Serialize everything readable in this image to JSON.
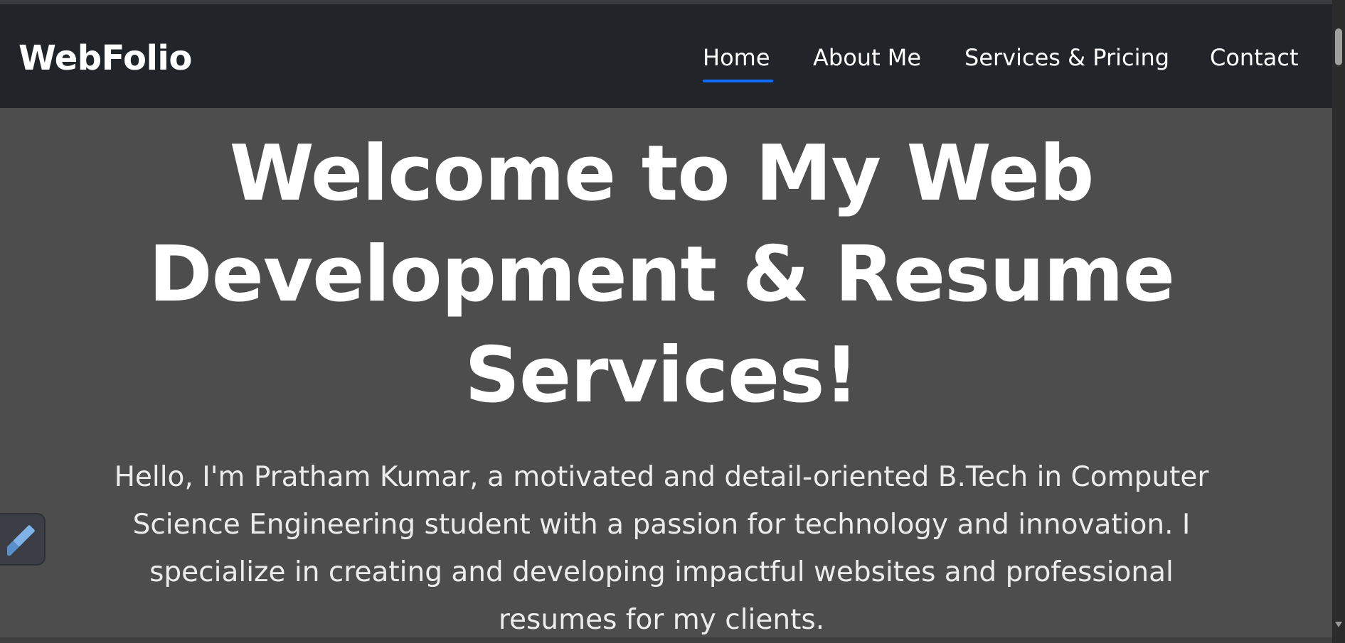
{
  "navbar": {
    "brand": "WebFolio",
    "links": [
      {
        "label": "Home",
        "active": true
      },
      {
        "label": "About Me",
        "active": false
      },
      {
        "label": "Services & Pricing",
        "active": false
      },
      {
        "label": "Contact",
        "active": false
      }
    ]
  },
  "hero": {
    "title_lines": [
      "Welcome to My Web",
      "Development & Resume",
      "Services!"
    ],
    "intro_lines": [
      "Hello, I'm Pratham Kumar, a motivated and detail-oriented B.Tech in Computer",
      "Science Engineering student with a passion for technology and innovation. I",
      "specialize in creating and developing impactful websites and professional",
      "resumes for my clients."
    ]
  },
  "widget": {
    "icon": "stacked-bars-icon"
  },
  "scrollbar": {
    "up_icon": "chevron-up-icon",
    "down_icon": "chevron-down-icon"
  },
  "colors": {
    "navbar_bg": "#212529",
    "page_bg": "#4d4d4d",
    "active_underline": "#0d6efd",
    "text": "#ffffff"
  }
}
